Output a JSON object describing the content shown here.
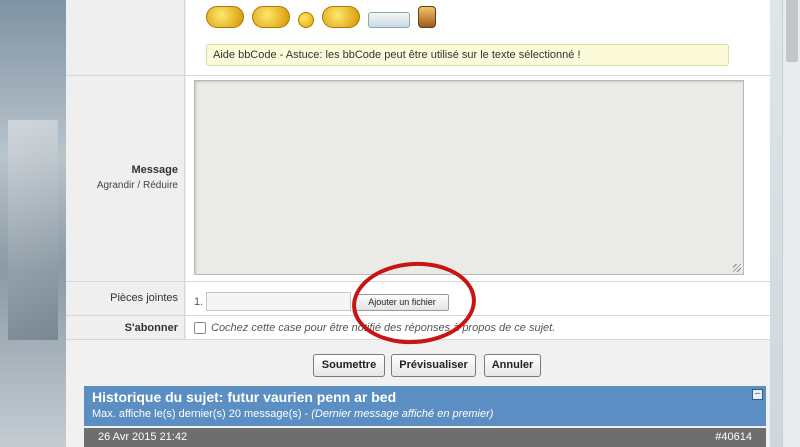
{
  "smileys": [
    "lifebuoy-smiley-icon",
    "rowing-boat-smiley-icon",
    "smiley-icon",
    "pirate-smiley-icon",
    "titanic-ship-smiley-icon",
    "barrel-smiley-icon"
  ],
  "help_bar": {
    "text": "Aide bbCode - Astuce: les bbCode peut être utilisé sur le texte sélectionné !"
  },
  "message": {
    "label": "Message",
    "enlarge": "Agrandir",
    "separator": "/",
    "reduce": "Réduire",
    "value": ""
  },
  "attachments": {
    "label": "Pièces jointes",
    "index": "1.",
    "button": "Ajouter un fichier"
  },
  "subscribe": {
    "label": "S'abonner",
    "checkbox_text": "Cochez cette case pour être notifié des réponses à propos de ce sujet."
  },
  "actions": {
    "submit": "Soumettre",
    "preview": "Prévisualiser",
    "cancel": "Annuler"
  },
  "history": {
    "title": "Historique du sujet: futur vaurien penn ar bed",
    "subtitle_prefix": "Max. affiche le(s) dernier(s) 20 message(s) - ",
    "subtitle_note": "(Dernier message affiché en premier)",
    "collapse": "–"
  },
  "post": {
    "date": "26 Avr 2015 21:42",
    "id": "#40614"
  },
  "colors": {
    "history_header": "#5b8ec2",
    "post_bar": "#6e6e6e",
    "annotation": "#c81414",
    "help_bar": "#fcfbd9"
  }
}
